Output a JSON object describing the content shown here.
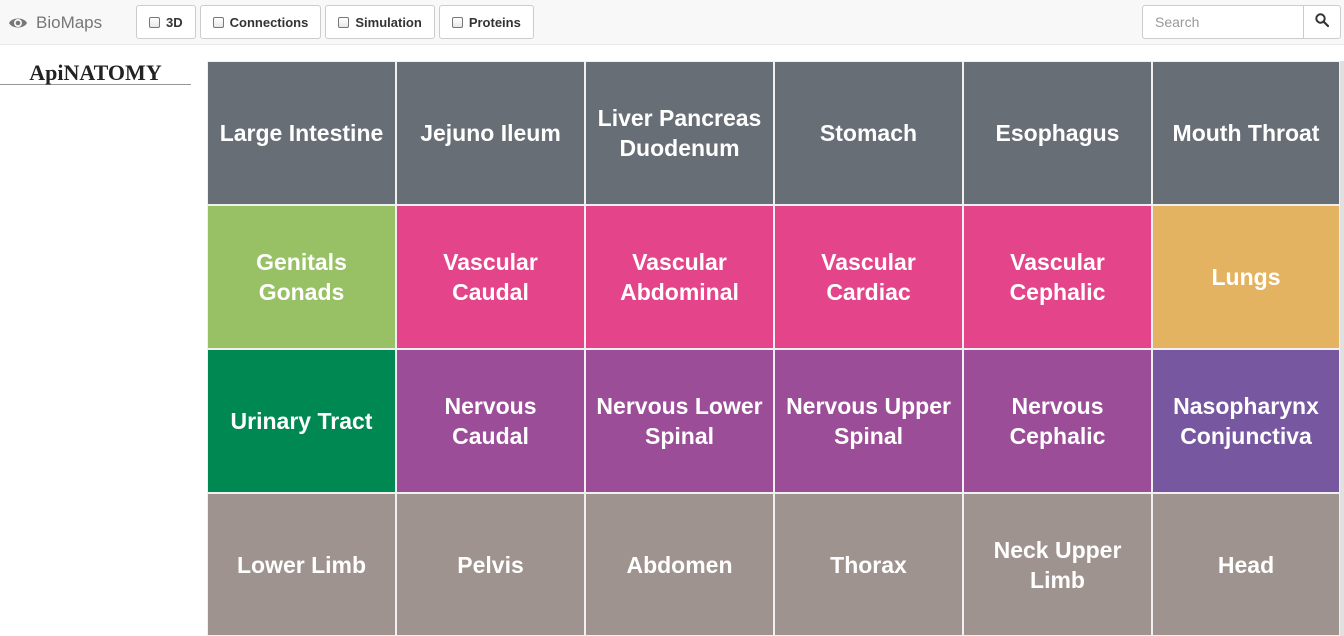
{
  "app": {
    "title": "BioMaps",
    "logo": "ApiNATOMY"
  },
  "toggles": [
    {
      "label": "3D",
      "checked": false
    },
    {
      "label": "Connections",
      "checked": false
    },
    {
      "label": "Simulation",
      "checked": false
    },
    {
      "label": "Proteins",
      "checked": false
    }
  ],
  "search": {
    "placeholder": "Search",
    "icon": "search-icon"
  },
  "colors": {
    "digestive": "#686e76",
    "vascular": "#e4458a",
    "reproductive": "#98c166",
    "respiratory": "#e4b361",
    "urinary": "#008852",
    "nervous": "#9c4d98",
    "immune": "#7657a0",
    "body": "#9e938e"
  },
  "tiles": [
    {
      "label": "Large Intestine",
      "color": "#686e76"
    },
    {
      "label": "Jejuno Ileum",
      "color": "#686e76"
    },
    {
      "label": "Liver Pancreas Duodenum",
      "color": "#686e76"
    },
    {
      "label": "Stomach",
      "color": "#686e76"
    },
    {
      "label": "Esophagus",
      "color": "#686e76"
    },
    {
      "label": "Mouth Throat",
      "color": "#686e76"
    },
    {
      "label": "Genitals Gonads",
      "color": "#98c166"
    },
    {
      "label": "Vascular Caudal",
      "color": "#e4458a"
    },
    {
      "label": "Vascular Abdominal",
      "color": "#e4458a"
    },
    {
      "label": "Vascular Cardiac",
      "color": "#e4458a"
    },
    {
      "label": "Vascular Cephalic",
      "color": "#e4458a"
    },
    {
      "label": "Lungs",
      "color": "#e4b361"
    },
    {
      "label": "Urinary Tract",
      "color": "#008852"
    },
    {
      "label": "Nervous Caudal",
      "color": "#9c4d98"
    },
    {
      "label": "Nervous Lower Spinal",
      "color": "#9c4d98"
    },
    {
      "label": "Nervous Upper Spinal",
      "color": "#9c4d98"
    },
    {
      "label": "Nervous Cephalic",
      "color": "#9c4d98"
    },
    {
      "label": "Nasopharynx Conjunctiva",
      "color": "#7657a0"
    },
    {
      "label": "Lower Limb",
      "color": "#9e938e"
    },
    {
      "label": "Pelvis",
      "color": "#9e938e"
    },
    {
      "label": "Abdomen",
      "color": "#9e938e"
    },
    {
      "label": "Thorax",
      "color": "#9e938e"
    },
    {
      "label": "Neck Upper Limb",
      "color": "#9e938e"
    },
    {
      "label": "Head",
      "color": "#9e938e"
    }
  ]
}
